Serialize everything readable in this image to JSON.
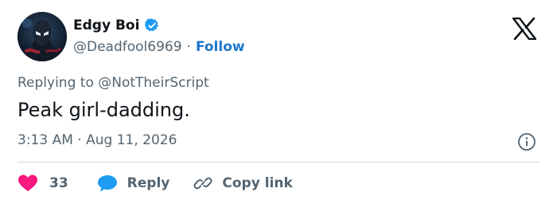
{
  "author": {
    "name": "Edgy Boi",
    "handle": "@Deadfool6969",
    "separator": "·",
    "follow_label": "Follow"
  },
  "tweet": {
    "replying_to": "Replying to @NotTheirScript",
    "text": "Peak girl-dadding.",
    "time": "3:13 AM",
    "time_separator": " · ",
    "date": "Aug 11, 2026"
  },
  "actions": {
    "like_count": "33",
    "reply_label": "Reply",
    "copy_link_label": "Copy link"
  },
  "colors": {
    "accent": "#1d76c9",
    "like": "#f91880",
    "reply": "#1d9bf0",
    "muted": "#536471",
    "text": "#0f1419"
  },
  "icons": {
    "verified": "verified-badge-icon",
    "brand": "x-logo-icon",
    "info": "info-icon",
    "like": "heart-icon",
    "reply": "reply-bubble-icon",
    "copy": "link-icon"
  }
}
